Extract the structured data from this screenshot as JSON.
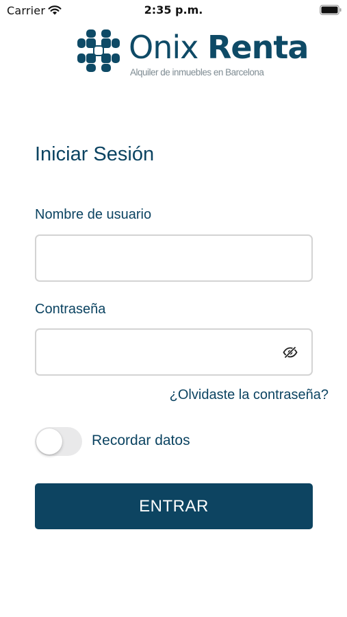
{
  "status_bar": {
    "carrier": "Carrier",
    "time": "2:35 p.m.",
    "wifi_icon": "wifi-icon",
    "battery_icon": "battery-icon"
  },
  "logo": {
    "name_light": "Onix",
    "name_bold": "Renta",
    "tagline": "Alquiler de inmuebles en Barcelona",
    "mark_icon": "onix-logo-mark"
  },
  "login": {
    "title": "Iniciar Sesión",
    "username_label": "Nombre de usuario",
    "username_value": "",
    "password_label": "Contraseña",
    "password_value": "",
    "password_toggle_icon": "eye-slash-icon",
    "forgot_password": "¿Olvidaste la contraseña?",
    "remember_label": "Recordar datos",
    "remember_enabled": false,
    "submit_label": "ENTRAR"
  },
  "colors": {
    "brand": "#0b4361",
    "button_background": "#0d4461",
    "field_border": "#d3d3d3",
    "toggle_off": "#e9e9ea"
  }
}
